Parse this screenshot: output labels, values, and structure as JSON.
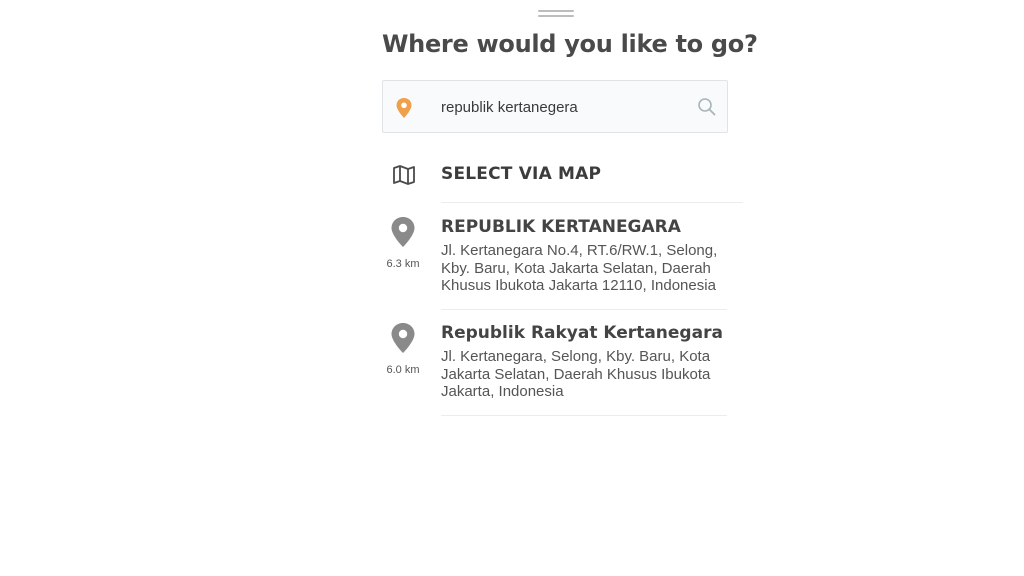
{
  "header": {
    "title": "Where would you like to go?"
  },
  "search": {
    "value": "republik kertanegera",
    "placeholder": "",
    "pin_color": "#f0a04b"
  },
  "select_via_map": {
    "label": "SELECT VIA MAP"
  },
  "results": [
    {
      "title": "REPUBLIK KERTANEGARA",
      "address": "Jl. Kertanegara No.4, RT.6/RW.1, Selong, Kby. Baru, Kota Jakarta Selatan, Daerah Khusus Ibukota Jakarta 12110, Indonesia",
      "distance": "6.3 km"
    },
    {
      "title": "Republik Rakyat Kertanegara",
      "address": "Jl. Kertanegara, Selong, Kby. Baru, Kota Jakarta Selatan, Daerah Khusus Ibukota Jakarta, Indonesia",
      "distance": "6.0 km"
    }
  ],
  "colors": {
    "accent_pin": "#f0a04b",
    "result_pin": "#8a8a8a",
    "text_dark": "#444444"
  }
}
